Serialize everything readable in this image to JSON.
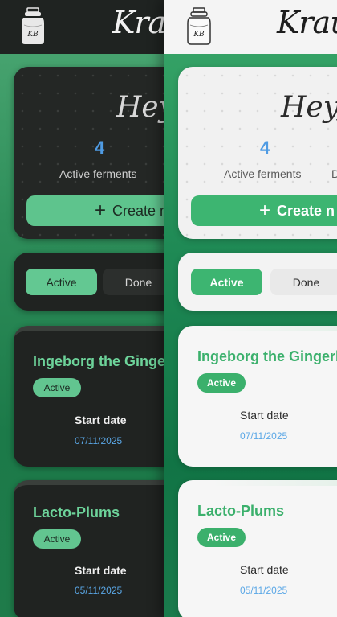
{
  "app": {
    "brand": "Krautk",
    "logo_text": "KB"
  },
  "hero": {
    "greeting": "Hey,",
    "active_count": "4",
    "active_label": "Active ferments",
    "second_label_fragment": "D",
    "create_label": "Create n"
  },
  "filter": {
    "active_label": "Active",
    "done_label": "Done"
  },
  "ferments": [
    {
      "name": "Ingeborg the Gingerb",
      "status": "Active",
      "start_label": "Start date",
      "start_date": "07/11/2025"
    },
    {
      "name": "Lacto-Plums",
      "status": "Active",
      "start_label": "Start date",
      "start_date": "05/11/2025"
    }
  ],
  "colors": {
    "accent": "#3db571",
    "date_blue": "#5aa7e6",
    "dark_card": "#202321"
  }
}
